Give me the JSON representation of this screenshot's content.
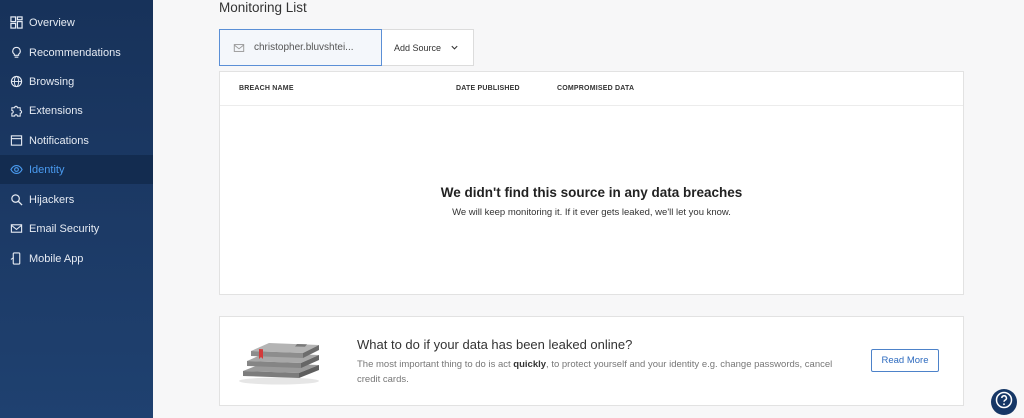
{
  "sidebar": {
    "items": [
      {
        "label": "Overview",
        "icon": "grid-icon"
      },
      {
        "label": "Recommendations",
        "icon": "lightbulb-icon"
      },
      {
        "label": "Browsing",
        "icon": "globe-icon"
      },
      {
        "label": "Extensions",
        "icon": "puzzle-icon"
      },
      {
        "label": "Notifications",
        "icon": "notification-icon"
      },
      {
        "label": "Identity",
        "icon": "eye-icon",
        "active": true
      },
      {
        "label": "Hijackers",
        "icon": "search-icon"
      },
      {
        "label": "Email Security",
        "icon": "mail-icon"
      },
      {
        "label": "Mobile App",
        "icon": "phone-icon"
      }
    ],
    "active_color": "#4a9bf0"
  },
  "main": {
    "title": "Monitoring List",
    "source": {
      "email": "christopher.bluvshtei...",
      "icon": "mail-icon",
      "add_source_label": "Add Source"
    },
    "table": {
      "columns": [
        "BREACH NAME",
        "DATE PUBLISHED",
        "COMPROMISED DATA"
      ],
      "empty_title": "We didn't find this source in any data breaches",
      "empty_subtitle": "We will keep monitoring it. If it ever gets leaked, we'll let you know."
    },
    "info": {
      "title": "What to do if your data has been leaked online?",
      "body_pre": "The most important thing to do is act ",
      "body_bold": "quickly",
      "body_post": ", to protect yourself and your identity e.g. change passwords, cancel credit cards.",
      "button_label": "Read More"
    }
  },
  "help": {
    "icon": "help-icon"
  }
}
